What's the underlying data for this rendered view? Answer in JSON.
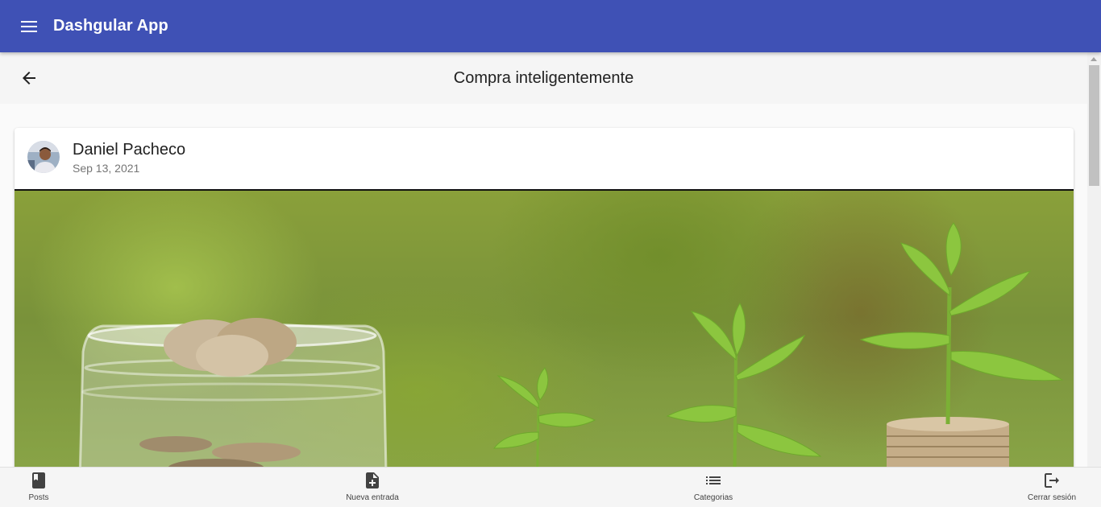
{
  "app": {
    "title": "Dashgular App"
  },
  "subheader": {
    "title": "Compra inteligentemente"
  },
  "post": {
    "author": "Daniel Pacheco",
    "date": "Sep 13, 2021"
  },
  "bottom_nav": {
    "items": [
      {
        "label": "Posts",
        "icon": "book-icon"
      },
      {
        "label": "Nueva entrada",
        "icon": "note-add-icon"
      },
      {
        "label": "Categorias",
        "icon": "list-icon"
      },
      {
        "label": "Cerrar sesión",
        "icon": "logout-icon"
      }
    ]
  },
  "colors": {
    "primary": "#3f51b5",
    "background": "#fafafa"
  }
}
